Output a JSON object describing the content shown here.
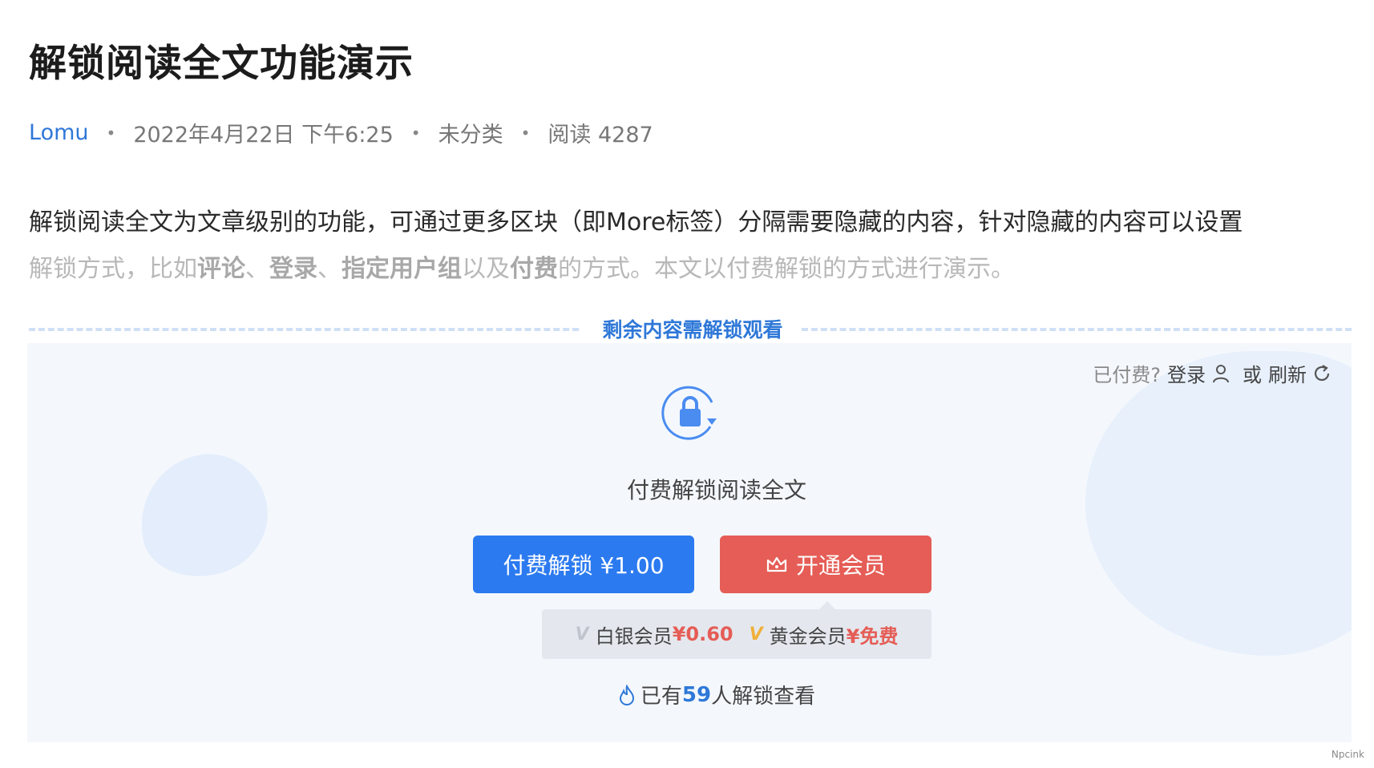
{
  "article": {
    "title": "解锁阅读全文功能演示",
    "meta": {
      "author": "Lomu",
      "date": "2022年4月22日 下午6:25",
      "category": "未分类",
      "reads": "阅读 4287"
    },
    "para1": "解锁阅读全文为文章级别的功能，可通过更多区块（即More标签）分隔需要隐藏的内容，针对隐藏的内容可以设置",
    "para2": {
      "t1": "解锁方式，比如",
      "b1": "评论",
      "t2": "、",
      "b2": "登录",
      "t3": "、",
      "b3": "指定用户组",
      "t4": "以及",
      "b4": "付费",
      "t5": "的方式。本文以付费解锁的方式进行演示。"
    }
  },
  "paywall": {
    "divider_label": "剩余内容需解锁观看",
    "paid_prompt": "已付费?",
    "login_label": "登录",
    "or_label": "或",
    "refresh_label": "刷新",
    "heading": "付费解锁阅读全文",
    "pay_button": "付费解锁 ¥1.00",
    "vip_button": "开通会员",
    "tiers": [
      {
        "icon": "vip-icon",
        "name": "白银会员",
        "price": "¥0.60",
        "icon_color": "#c0c4cc"
      },
      {
        "icon": "vip-icon",
        "name": "黄金会员",
        "price": "¥免费",
        "icon_color": "#f0b03a"
      }
    ],
    "unlocked_prefix": "已有",
    "unlocked_count": "59",
    "unlocked_suffix": "人解锁查看",
    "colors": {
      "accent": "#2b7af0",
      "vip": "#e55d56",
      "link": "#2f78d8"
    }
  },
  "watermark": "Npcink"
}
